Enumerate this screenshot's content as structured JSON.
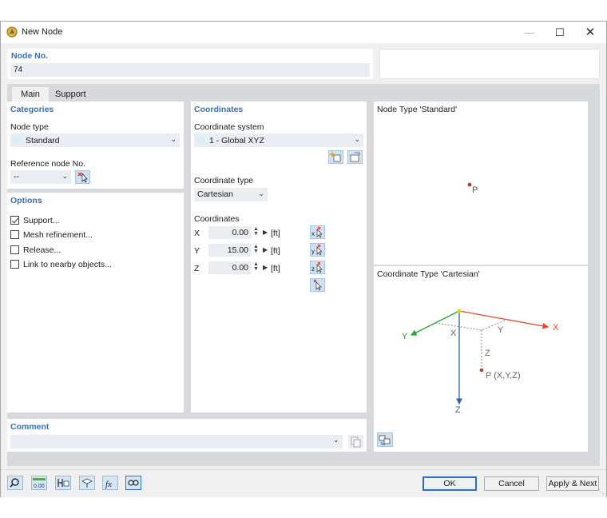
{
  "window": {
    "title": "New Node",
    "minimize_glyph": "—",
    "maximize_glyph": "☐",
    "close_glyph": "✕"
  },
  "node_no": {
    "label": "Node No.",
    "value": "74"
  },
  "tabs": [
    {
      "label": "Main"
    },
    {
      "label": "Support"
    }
  ],
  "categories": {
    "title": "Categories",
    "node_type_label": "Node type",
    "node_type_value": "Standard",
    "reference_node_label": "Reference node No.",
    "reference_node_value": "--"
  },
  "options": {
    "title": "Options",
    "items": [
      {
        "label": "Support...",
        "checked": true
      },
      {
        "label": "Mesh refinement...",
        "checked": false
      },
      {
        "label": "Release...",
        "checked": false
      },
      {
        "label": "Link to nearby objects...",
        "checked": false
      }
    ]
  },
  "coordinates": {
    "title": "Coordinates",
    "system_label": "Coordinate system",
    "system_value": "1 - Global XYZ",
    "type_label": "Coordinate type",
    "type_value": "Cartesian",
    "values_label": "Coordinates",
    "rows": [
      {
        "axis": "X",
        "value": "0.00",
        "unit": "[ft]"
      },
      {
        "axis": "Y",
        "value": "15.00",
        "unit": "[ft]"
      },
      {
        "axis": "Z",
        "value": "0.00",
        "unit": "[ft]"
      }
    ]
  },
  "node_type_preview": {
    "title": "Node Type 'Standard'",
    "point_label": "P"
  },
  "coord_type_preview": {
    "title": "Coordinate Type 'Cartesian'",
    "axis_x": "X",
    "axis_y": "Y",
    "axis_z": "Z",
    "proj_x": "X",
    "proj_y": "Y",
    "proj_z": "Z",
    "point_label": "P (X,Y,Z)",
    "colors": {
      "x": "#e0492a",
      "y": "#2e9e3e",
      "z": "#2f5fb0"
    }
  },
  "comment": {
    "title": "Comment",
    "value": ""
  },
  "buttons": {
    "ok": "OK",
    "cancel": "Cancel",
    "apply_next": "Apply & Next"
  },
  "bottom_icons": [
    "search-icon",
    "decimal-icon",
    "model-icon",
    "view-icon",
    "function-icon",
    "settings-icon"
  ],
  "icon_text": {
    "decimal": "0.00",
    "function": "fx"
  }
}
